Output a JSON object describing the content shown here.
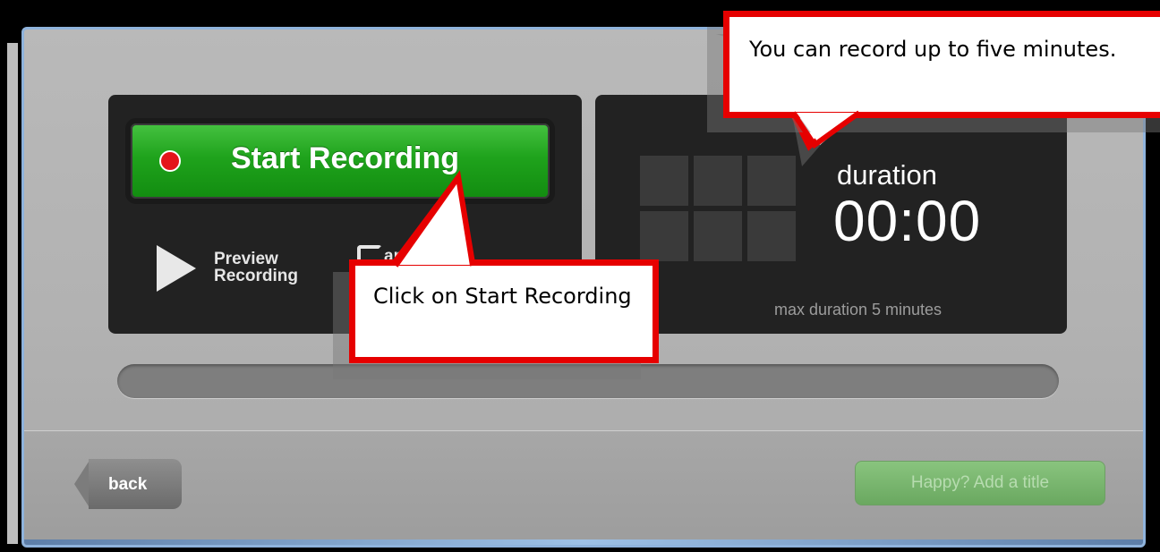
{
  "recorder": {
    "start_button_label": "Start Recording",
    "preview_label": "Preview Recording",
    "restart_partial_label": "art",
    "duration_label": "duration",
    "duration_value": "00:00",
    "max_duration_text": "max duration 5 minutes",
    "progress_fraction": 0
  },
  "footer": {
    "back_label": "back",
    "title_button_label": "Happy? Add a title"
  },
  "callouts": {
    "top": "You can record up to five minutes.",
    "bottom": "Click on Start Recording"
  },
  "icons": [
    "record-dot-icon",
    "play-icon",
    "restart-icon"
  ],
  "colors": {
    "start_green": "#1fa31c",
    "record_red": "#e3141a",
    "callout_border": "#e60000",
    "title_button_green": "#6aa860"
  }
}
